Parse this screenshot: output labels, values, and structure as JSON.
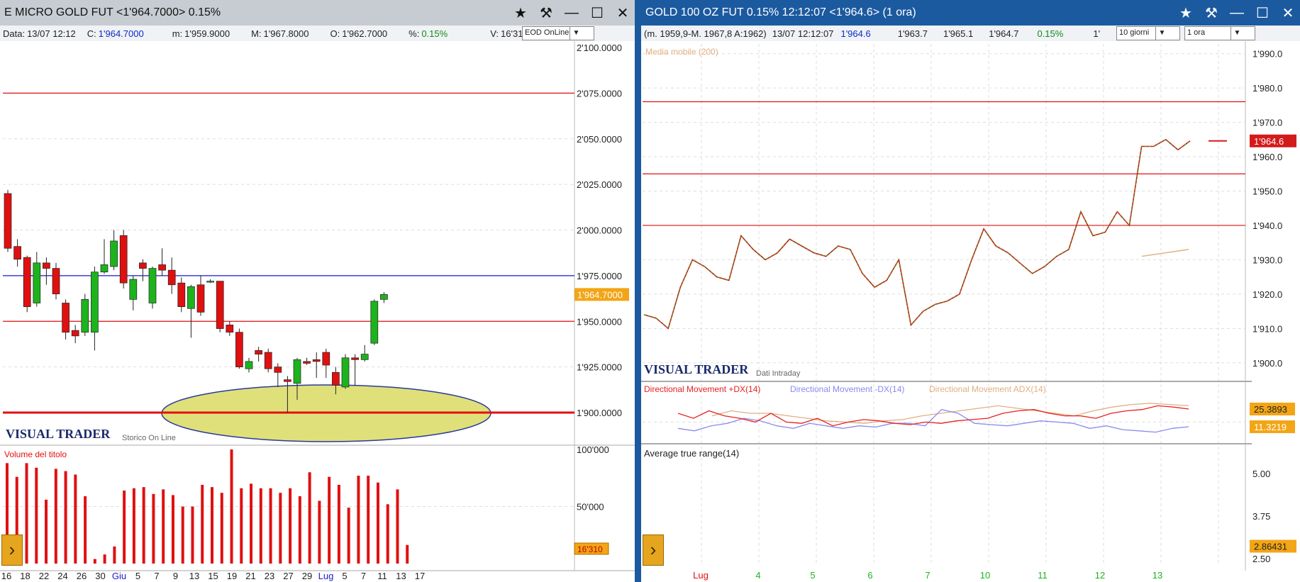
{
  "left": {
    "title": "E MICRO GOLD FUT <1'964.7000> 0.15%",
    "info": {
      "date_label": "Data:",
      "date_value": "13/07 12:12",
      "close_label": "C:",
      "close_value": "1'964.7000",
      "min_label": "m:",
      "min_value": "1'959.9000",
      "max_label": "M:",
      "max_value": "1'967.8000",
      "open_label": "O:",
      "open_value": "1'962.7000",
      "pct_label": "%:",
      "pct_value": "0.15%",
      "vol_label": "V:",
      "vol_value": "16'310"
    },
    "select_value": "EOD OnLine",
    "brand": "VISUAL TRADER",
    "brand_sub": "Storico On Line",
    "volume_label": "Volume del titolo",
    "price_axis_labels": [
      "2'100.0000",
      "2'075.0000",
      "2'050.0000",
      "2'025.0000",
      "2'000.0000",
      "1'975.0000",
      "1'950.0000",
      "1'925.0000",
      "1'900.0000"
    ],
    "price_tag": "1'964.7000",
    "volume_axis_labels": [
      "100'000",
      "50'000"
    ],
    "volume_tag": "16'310",
    "x_labels": [
      "16",
      "18",
      "22",
      "24",
      "26",
      "30",
      "Giu",
      "5",
      "7",
      "9",
      "13",
      "15",
      "19",
      "21",
      "23",
      "27",
      "29",
      "Lug",
      "5",
      "7",
      "11",
      "13",
      "17"
    ]
  },
  "right": {
    "title": "GOLD 100 OZ FUT 0.15% 12:12:07  <1'964.6> (1 ora)",
    "info": {
      "range": "(m. 1959,9-M. 1967,8 A:1962)",
      "datetime": "13/07 12:12:07",
      "last": "1'964.6",
      "v1": "1'963.7",
      "v2": "1'965.1",
      "v3": "1'964.7",
      "pct": "0.15%",
      "trunc": "1'"
    },
    "select_period": "10 giorni",
    "select_interval": "1 ora",
    "ma_label": "Media mobile (200)",
    "brand": "VISUAL TRADER",
    "brand_sub": "Dati Intraday",
    "price_axis_labels": [
      "1'990.0",
      "1'980.0",
      "1'970.0",
      "1'960.0",
      "1'950.0",
      "1'940.0",
      "1'930.0",
      "1'920.0",
      "1'910.0",
      "1'900.0"
    ],
    "price_tag": "1'964.6",
    "dm_labels": [
      "Directional Movement +DX(14)",
      "Directional Movement -DX(14)",
      "Directional Movement ADX(14)"
    ],
    "dm_tag": "25.3893",
    "dm_tag2": "11.3219",
    "atr_label": "Average true range(14)",
    "atr_axis_labels": [
      "5.00",
      "3.75",
      "2.50"
    ],
    "atr_tag": "2.86431",
    "x_labels": [
      "Lug",
      "4",
      "5",
      "6",
      "7",
      "10",
      "11",
      "12",
      "13"
    ]
  },
  "colors": {
    "up_candle": "#1db31d",
    "down_candle": "#e01010",
    "support_line": "#e01010",
    "blue_line": "#1a1acc",
    "ellipse_fill": "#e0e07a",
    "price_tag_bg": "#f2a516",
    "dx_plus": "#e82020",
    "dx_minus": "#8a8af0",
    "adx": "#e0b080",
    "ma": "#e0b080"
  },
  "chart_data": [
    {
      "type": "candlestick",
      "title": "E MICRO GOLD FUT",
      "ylim": [
        1900,
        2100
      ],
      "horizontal_lines": [
        {
          "value": 2075,
          "color": "red"
        },
        {
          "value": 1975,
          "color": "blue"
        },
        {
          "value": 1950,
          "color": "red"
        },
        {
          "value": 1900,
          "color": "red"
        }
      ],
      "candles": [
        {
          "o": 2020,
          "h": 2022,
          "c": 1990,
          "l": 1988
        },
        {
          "o": 1991,
          "h": 1995,
          "c": 1984,
          "l": 1980
        },
        {
          "o": 1985,
          "h": 1986,
          "c": 1958,
          "l": 1955
        },
        {
          "o": 1960,
          "h": 1988,
          "c": 1982,
          "l": 1958
        },
        {
          "o": 1982,
          "h": 1985,
          "c": 1979,
          "l": 1970
        },
        {
          "o": 1979,
          "h": 1982,
          "c": 1965,
          "l": 1962
        },
        {
          "o": 1960,
          "h": 1962,
          "c": 1944,
          "l": 1940
        },
        {
          "o": 1945,
          "h": 1948,
          "c": 1942,
          "l": 1938
        },
        {
          "o": 1944,
          "h": 1965,
          "c": 1962,
          "l": 1942
        },
        {
          "o": 1944,
          "h": 1980,
          "c": 1977,
          "l": 1934
        },
        {
          "o": 1977,
          "h": 1995,
          "c": 1981,
          "l": 1976
        },
        {
          "o": 1980,
          "h": 2000,
          "c": 1994,
          "l": 1978
        },
        {
          "o": 1997,
          "h": 2000,
          "c": 1971,
          "l": 1968
        },
        {
          "o": 1962,
          "h": 1975,
          "c": 1973,
          "l": 1956
        },
        {
          "o": 1982,
          "h": 1984,
          "c": 1979,
          "l": 1972
        },
        {
          "o": 1960,
          "h": 1980,
          "c": 1979,
          "l": 1957
        },
        {
          "o": 1981,
          "h": 1990,
          "c": 1978,
          "l": 1975
        },
        {
          "o": 1978,
          "h": 1985,
          "c": 1970,
          "l": 1965
        },
        {
          "o": 1971,
          "h": 1974,
          "c": 1958,
          "l": 1955
        },
        {
          "o": 1957,
          "h": 1970,
          "c": 1969,
          "l": 1941
        },
        {
          "o": 1970,
          "h": 1975,
          "c": 1955,
          "l": 1953
        },
        {
          "o": 1972,
          "h": 1973,
          "c": 1972,
          "l": 1971
        },
        {
          "o": 1972,
          "h": 1972,
          "c": 1946,
          "l": 1944
        },
        {
          "o": 1948,
          "h": 1950,
          "c": 1944,
          "l": 1942
        },
        {
          "o": 1944,
          "h": 1946,
          "c": 1925,
          "l": 1924
        },
        {
          "o": 1924,
          "h": 1930,
          "c": 1928,
          "l": 1922
        },
        {
          "o": 1934,
          "h": 1936,
          "c": 1932,
          "l": 1928
        },
        {
          "o": 1933,
          "h": 1935,
          "c": 1924,
          "l": 1922
        },
        {
          "o": 1925,
          "h": 1927,
          "c": 1922,
          "l": 1914
        },
        {
          "o": 1918,
          "h": 1920,
          "c": 1917,
          "l": 1900
        },
        {
          "o": 1916,
          "h": 1930,
          "c": 1929,
          "l": 1907
        },
        {
          "o": 1928,
          "h": 1930,
          "c": 1927,
          "l": 1926
        },
        {
          "o": 1929,
          "h": 1933,
          "c": 1928,
          "l": 1919
        },
        {
          "o": 1933,
          "h": 1935,
          "c": 1926,
          "l": 1919
        },
        {
          "o": 1922,
          "h": 1925,
          "c": 1915,
          "l": 1910
        },
        {
          "o": 1914,
          "h": 1932,
          "c": 1930,
          "l": 1913
        },
        {
          "o": 1930,
          "h": 1932,
          "c": 1929,
          "l": 1915
        },
        {
          "o": 1929,
          "h": 1937,
          "c": 1932,
          "l": 1928
        },
        {
          "o": 1938,
          "h": 1962,
          "c": 1961,
          "l": 1937
        },
        {
          "o": 1962,
          "h": 1966,
          "c": 1964.7,
          "l": 1960
        }
      ],
      "volume": [
        88000,
        76000,
        88000,
        84000,
        56000,
        83000,
        81000,
        78000,
        59000,
        4000,
        8000,
        15000,
        64000,
        66000,
        67000,
        61000,
        65000,
        60000,
        50000,
        50000,
        69000,
        67000,
        62000,
        100000,
        66000,
        70000,
        66000,
        66000,
        62000,
        66000,
        59000,
        80000,
        55000,
        76000,
        69000,
        49000,
        77000,
        77000,
        71000,
        52000,
        65000,
        16310
      ],
      "volume_ylim": [
        0,
        100000
      ],
      "x_labels": [
        "16",
        "18",
        "22",
        "24",
        "26",
        "30",
        "Giu",
        "5",
        "7",
        "9",
        "13",
        "15",
        "19",
        "21",
        "23",
        "27",
        "29",
        "Lug",
        "5",
        "7",
        "11",
        "13",
        "17"
      ]
    },
    {
      "type": "line",
      "title": "GOLD 100 OZ FUT",
      "ylim": [
        1895,
        1992
      ],
      "horizontal_lines": [
        1976,
        1955,
        1940
      ],
      "price_series": [
        1914,
        1913,
        1910,
        1922,
        1930,
        1928,
        1925,
        1924,
        1937,
        1933,
        1930,
        1932,
        1936,
        1934,
        1932,
        1931,
        1934,
        1933,
        1926,
        1922,
        1924,
        1930,
        1911,
        1915,
        1917,
        1918,
        1920,
        1930,
        1939,
        1934,
        1932,
        1929,
        1926,
        1928,
        1931,
        1933,
        1944,
        1937,
        1938,
        1944,
        1940,
        1963,
        1963,
        1965,
        1962,
        1964.6
      ],
      "dx_plus": [
        22,
        18,
        24,
        20,
        18,
        15,
        22,
        15,
        14,
        18,
        12,
        15,
        17,
        16,
        14,
        13,
        15,
        14,
        16,
        17,
        18,
        22,
        24,
        25,
        22,
        20,
        20,
        18,
        22,
        24,
        25,
        28,
        27,
        25.4
      ],
      "dx_minus": [
        10,
        8,
        12,
        14,
        18,
        16,
        12,
        10,
        14,
        12,
        10,
        12,
        11,
        14,
        14,
        12,
        25,
        22,
        14,
        13,
        12,
        14,
        16,
        15,
        14,
        10,
        12,
        9,
        8,
        7,
        10,
        11.3
      ],
      "adx": [
        20,
        24,
        22,
        22,
        20,
        18,
        16,
        15,
        14,
        16,
        17,
        20,
        22,
        24,
        26,
        28,
        26,
        24,
        22,
        20,
        24,
        27,
        29,
        30,
        29,
        28
      ],
      "atr_ylim": [
        2.5,
        5.0
      ],
      "atr_last": 2.86431,
      "x_labels": [
        "Lug",
        "4",
        "5",
        "6",
        "7",
        "10",
        "11",
        "12",
        "13"
      ]
    }
  ]
}
